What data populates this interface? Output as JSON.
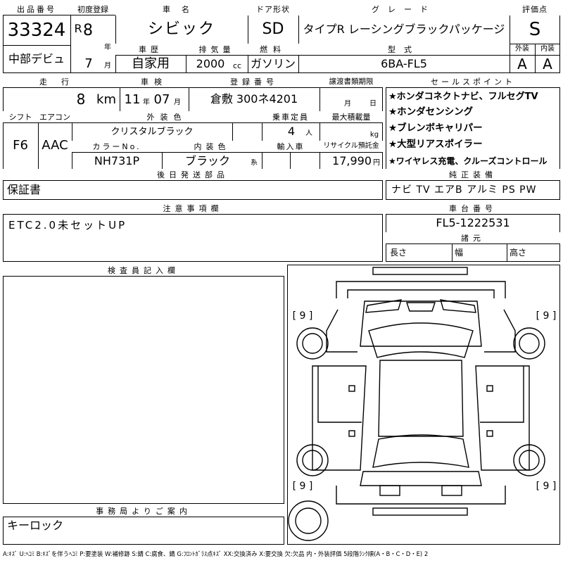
{
  "lot": {
    "label": "出品番号",
    "number": "33324",
    "venue": "中部デビュ"
  },
  "first_reg": {
    "label": "初度登録",
    "era": "R",
    "year": "8",
    "year_unit": "年",
    "month": "7",
    "month_unit": "月"
  },
  "car_name": {
    "label": "車名",
    "value": "シビック"
  },
  "door": {
    "label": "ドア形状",
    "value": "SD"
  },
  "grade": {
    "label": "グレード",
    "value": "タイプR レーシングブラックパッケージ"
  },
  "score": {
    "label": "評価点",
    "value": "S",
    "ext_label": "外装",
    "ext_value": "A",
    "int_label": "内装",
    "int_value": "A"
  },
  "history": {
    "label": "車歴",
    "value": "自家用"
  },
  "displacement": {
    "label": "排気量",
    "value": "2000",
    "unit": "cc"
  },
  "fuel": {
    "label": "燃料",
    "value": "ガソリン"
  },
  "model_code": {
    "label": "型式",
    "value": "6BA-FL5"
  },
  "mileage": {
    "label": "走行",
    "value": "8",
    "unit": "km"
  },
  "inspection": {
    "label": "車検",
    "year": "11",
    "year_unit": "年",
    "month": "07",
    "month_unit": "月"
  },
  "plate": {
    "label": "登録番号",
    "value": "倉敷 300ネ4201"
  },
  "transfer": {
    "label": "譲渡書類期限",
    "month_unit": "月",
    "day_unit": "日"
  },
  "shift": {
    "label": "シフト",
    "value": "F6"
  },
  "aircon": {
    "label": "エアコン",
    "value": "AAC"
  },
  "ext_color": {
    "label": "外装色",
    "value": "クリスタルブラック"
  },
  "capacity": {
    "label": "乗車定員",
    "value": "4",
    "unit": "人"
  },
  "load": {
    "label": "最大積載量",
    "unit": "kg"
  },
  "color_no": {
    "label": "カラーNo.",
    "value": "NH731P"
  },
  "int_color": {
    "label": "内装色",
    "value": "ブラック",
    "suffix": "系"
  },
  "import": {
    "label": "輸入車"
  },
  "recycle": {
    "label": "リサイクル預託金",
    "value": "17,990",
    "unit": "円"
  },
  "later_parts": {
    "label": "後日発送部品",
    "value": "保証書"
  },
  "sales_points": {
    "label": "セールスポイント",
    "items": [
      "★ホンダコネクトナビ、フルセグTV",
      "★ホンダセンシング",
      "★ブレンボキャリパー",
      "★大型リアスポイラー",
      "★ワイヤレス充電、クルーズコントロール"
    ]
  },
  "genuine": {
    "label": "純正装備",
    "value": "ナビ TV エアB アルミ PS PW"
  },
  "notes": {
    "label": "注意事項欄",
    "value": "ETC2.0未セットUP"
  },
  "chassis": {
    "label": "車台番号",
    "value": "FL5-1222531"
  },
  "dims": {
    "label": "諸元",
    "length": "長さ",
    "width": "幅",
    "height": "高さ"
  },
  "inspector": {
    "label": "検査員記入欄"
  },
  "office": {
    "label": "事務局よりご案内",
    "value": "キーロック"
  },
  "tire_marks": [
    "[ 9 ]",
    "[ 9 ]",
    "[ 9 ]",
    "[ 9 ]"
  ],
  "legend": "A:ｷｽﾞ U:ﾍｺﾐ B:ｷｽﾞを伴うﾍｺﾐ P:要塗装 W:補修跡 S:錆 C:腐食、錆 G:ﾌﾛﾝﾄｶﾞﾗｽ点ｷｽﾞ XX:交換済み X:要交換 欠:欠品 内・外装評価 5段階ﾗﾝｸ順(A・B・C・D・E) 2"
}
